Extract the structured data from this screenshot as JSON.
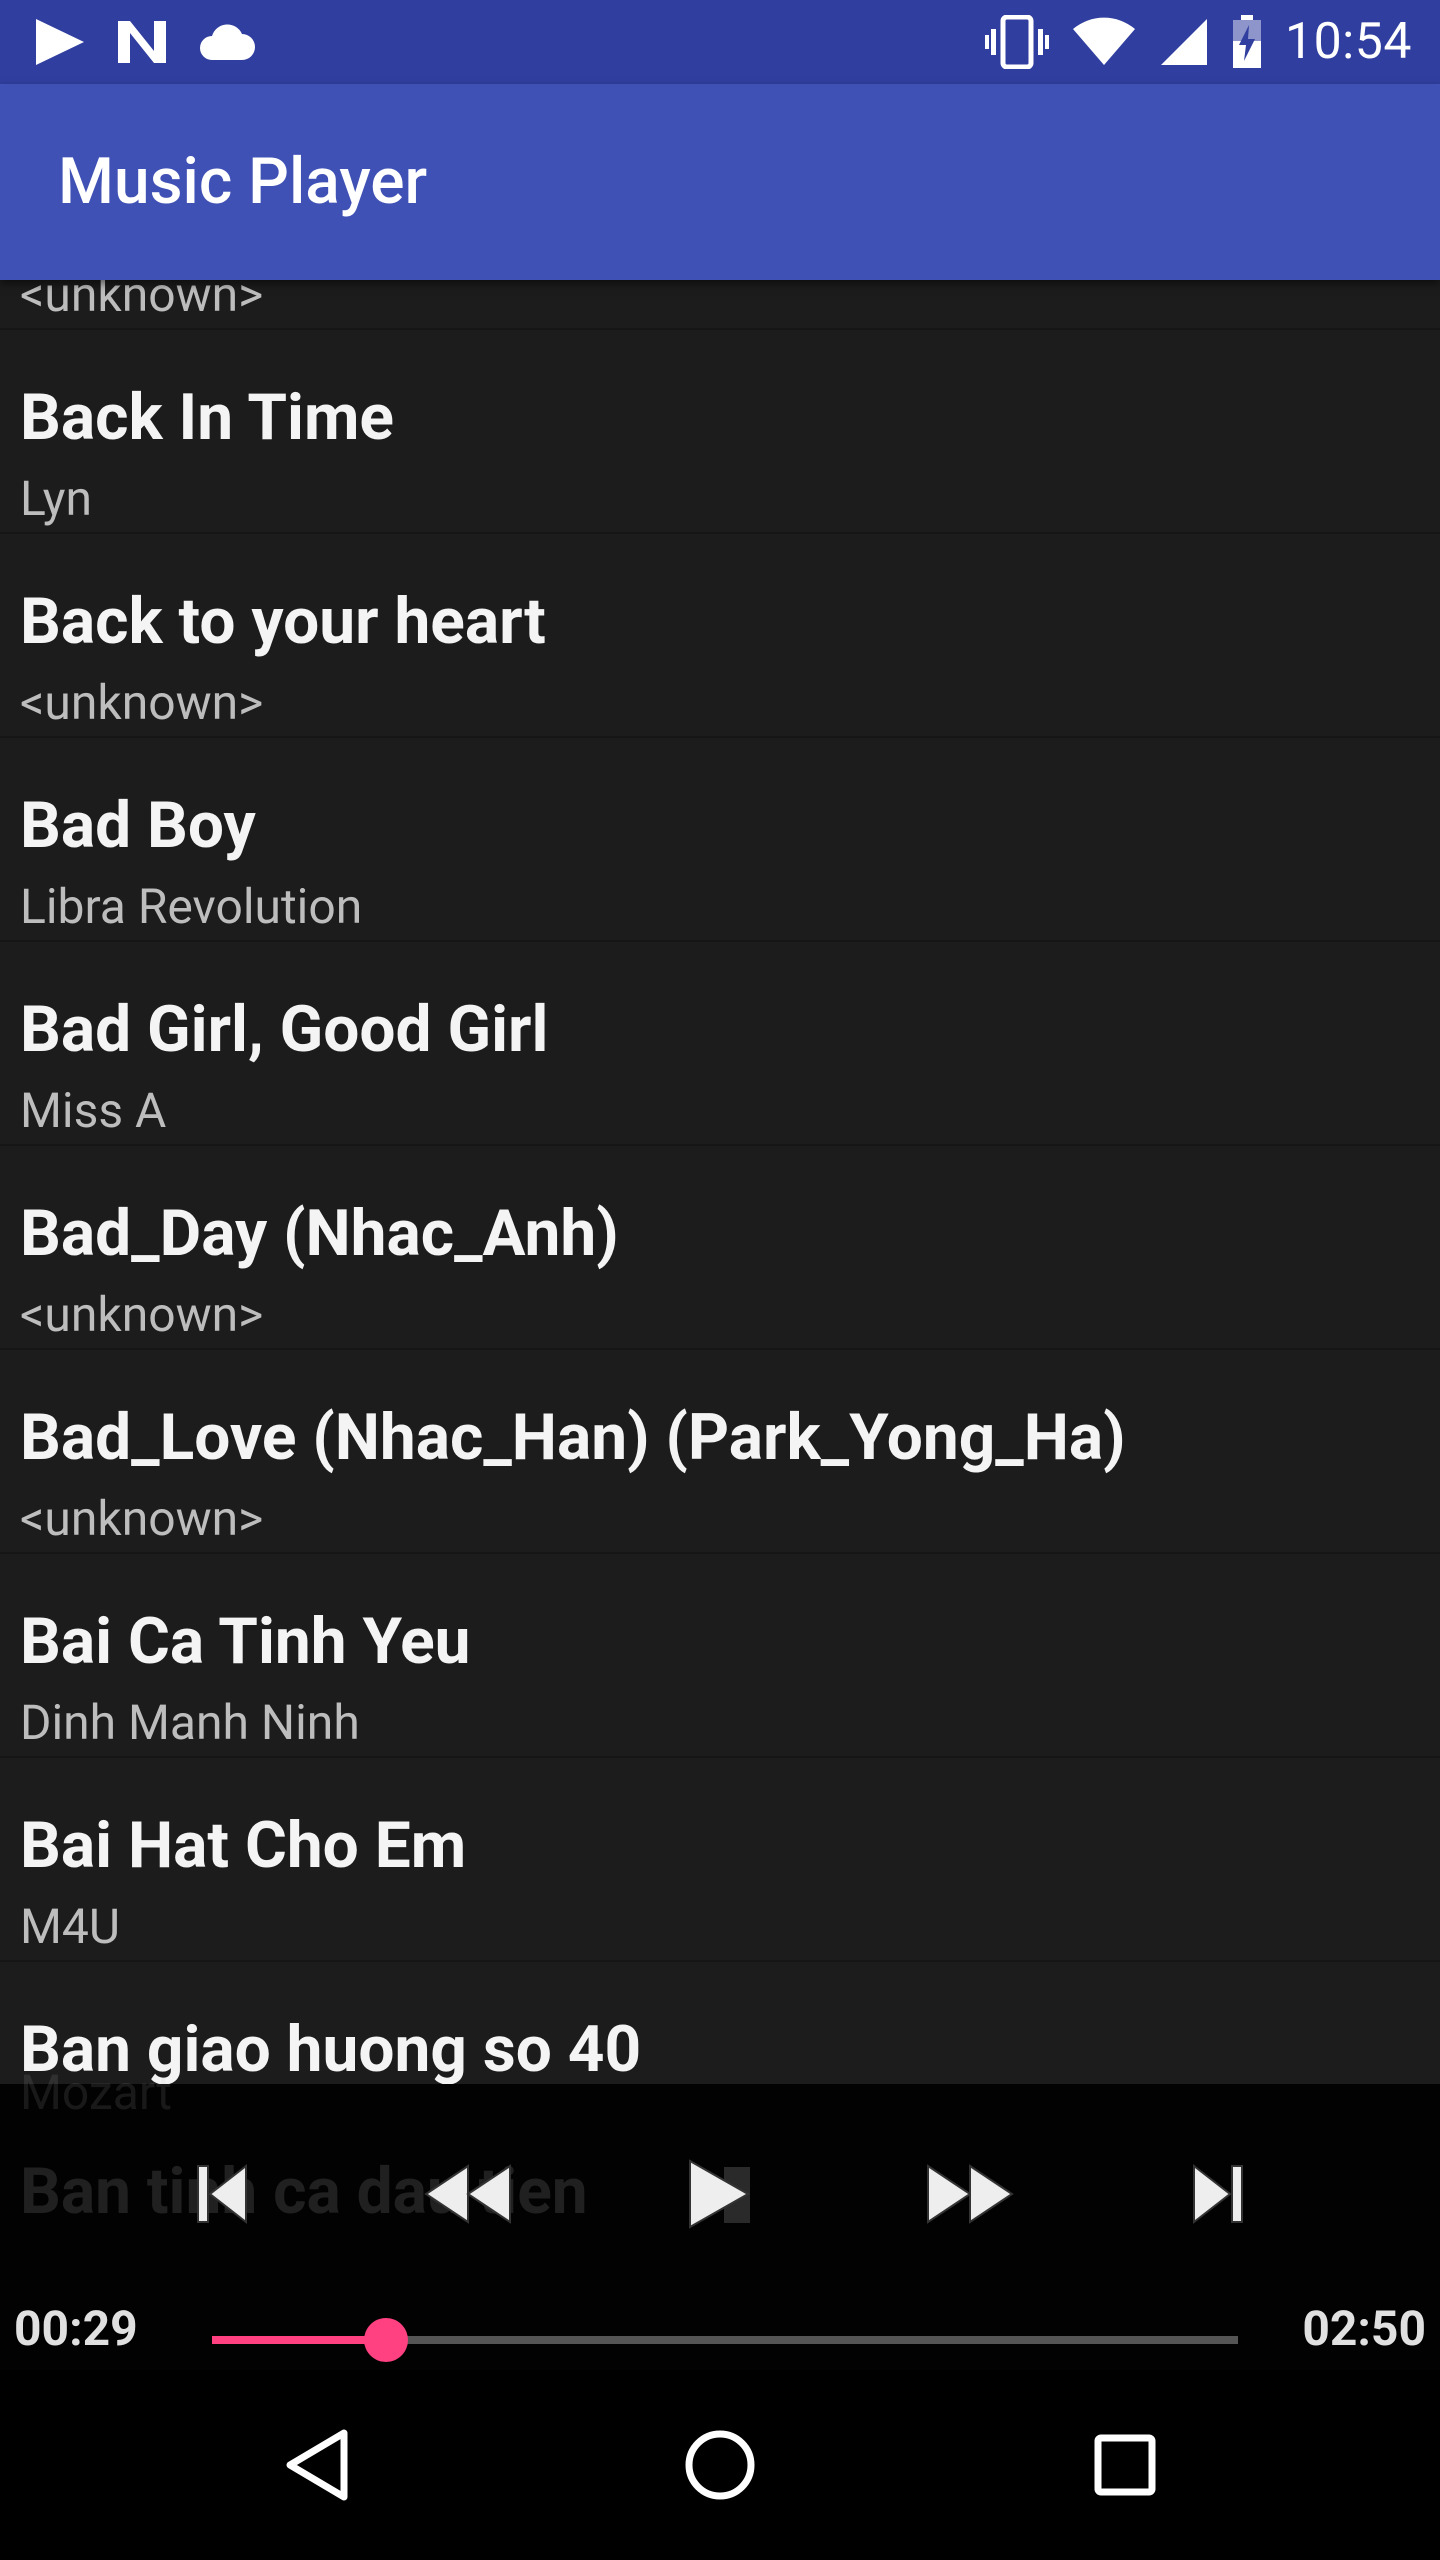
{
  "status_bar": {
    "time": "10:54",
    "icons_left": [
      "play-store-icon",
      "n-notification-icon",
      "cloud-icon"
    ],
    "icons_right": [
      "vibrate-icon",
      "wifi-icon",
      "signal-icon",
      "battery-charging-icon"
    ]
  },
  "app_bar": {
    "title": "Music Player"
  },
  "songs": [
    {
      "title": "",
      "artist": "<unknown>"
    },
    {
      "title": "Back In Time",
      "artist": "Lyn"
    },
    {
      "title": "Back to your heart",
      "artist": "<unknown>"
    },
    {
      "title": "Bad Boy",
      "artist": "Libra Revolution"
    },
    {
      "title": "Bad Girl, Good Girl",
      "artist": "Miss A"
    },
    {
      "title": "Bad_Day (Nhac_Anh)",
      "artist": "<unknown>"
    },
    {
      "title": "Bad_Love (Nhac_Han) (Park_Yong_Ha)",
      "artist": "<unknown>"
    },
    {
      "title": "Bai Ca Tinh Yeu",
      "artist": "Dinh Manh Ninh"
    },
    {
      "title": "Bai Hat Cho Em",
      "artist": "M4U"
    },
    {
      "title": "Ban giao huong so 40",
      "artist": "Mozart"
    },
    {
      "title": "Ban tinh ca dau tien",
      "artist": ""
    }
  ],
  "player": {
    "elapsed": "00:29",
    "duration": "02:50",
    "progress_fraction": 0.17,
    "accent_color": "#ff4081",
    "controls": [
      "skip-previous-icon",
      "rewind-icon",
      "play-icon",
      "fast-forward-icon",
      "skip-next-icon"
    ]
  },
  "nav_bar": {
    "buttons": [
      "back-icon",
      "home-icon",
      "recents-icon"
    ]
  },
  "colors": {
    "status_bar": "#303f9f",
    "app_bar": "#3f51b5",
    "list_background": "#1c1c1c"
  }
}
